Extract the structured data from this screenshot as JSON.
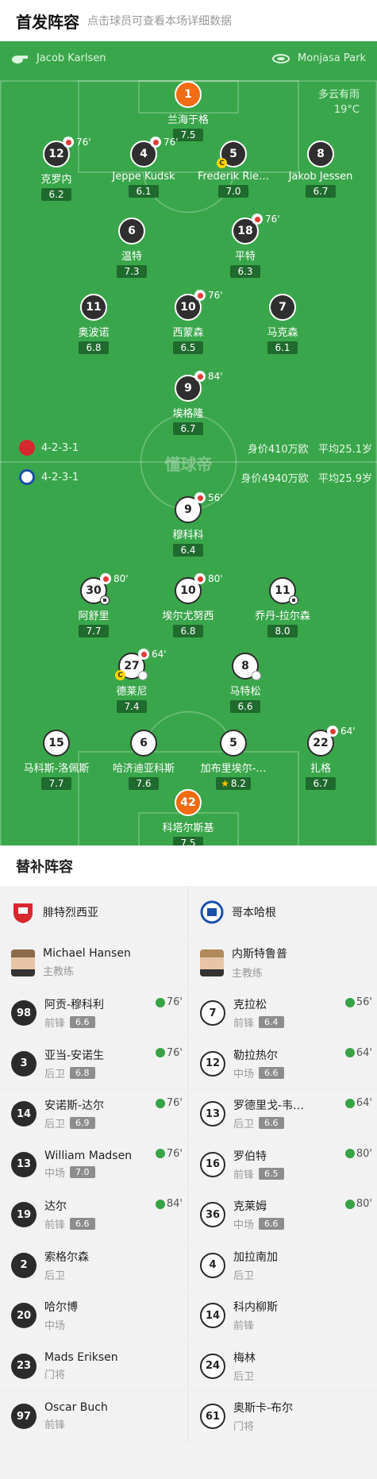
{
  "header": {
    "title": "首发阵容",
    "subtitle": "点击球员可查看本场详细数据"
  },
  "match": {
    "referee": "Jacob Karlsen",
    "venue": "Monjasa Park",
    "weather": "多云有雨",
    "temperature": "19°C"
  },
  "home_team": {
    "name": "腓特烈西亚",
    "formation": "4-2-3-1",
    "value": "身价410万欧",
    "avg_age": "平均25.1岁",
    "color": "#d7282f"
  },
  "away_team": {
    "name": "哥本哈根",
    "formation": "4-2-3-1",
    "value": "身价4940万欧",
    "avg_age": "平均25.9岁",
    "color": "#1b4fa8"
  },
  "watermark": "懂球帝",
  "home_lineup": [
    {
      "num": "1",
      "name": "兰海于格",
      "rating": "7.5"
    },
    {
      "num": "12",
      "name": "克罗内",
      "rating": "6.2",
      "sub": "76'"
    },
    {
      "num": "4",
      "name": "Jeppe Kudsk",
      "rating": "6.1",
      "sub": "76'"
    },
    {
      "num": "5",
      "name": "Frederik Rie…",
      "rating": "7.0",
      "captain": "C"
    },
    {
      "num": "8",
      "name": "Jakob Jessen",
      "rating": "6.7"
    },
    {
      "num": "6",
      "name": "温特",
      "rating": "7.3"
    },
    {
      "num": "18",
      "name": "平特",
      "rating": "6.3",
      "sub": "76'"
    },
    {
      "num": "11",
      "name": "奥波诺",
      "rating": "6.8"
    },
    {
      "num": "10",
      "name": "西蒙森",
      "rating": "6.5",
      "sub": "76'"
    },
    {
      "num": "7",
      "name": "马克森",
      "rating": "6.1"
    },
    {
      "num": "9",
      "name": "埃格隆",
      "rating": "6.7",
      "sub": "84'"
    }
  ],
  "away_lineup": [
    {
      "num": "9",
      "name": "穆科科",
      "rating": "6.4",
      "sub": "56'"
    },
    {
      "num": "30",
      "name": "阿舒里",
      "rating": "7.7",
      "sub": "80'"
    },
    {
      "num": "10",
      "name": "埃尔尤努西",
      "rating": "6.8",
      "sub": "80'"
    },
    {
      "num": "11",
      "name": "乔丹-拉尔森",
      "rating": "8.0"
    },
    {
      "num": "27",
      "name": "德莱尼",
      "rating": "7.4",
      "sub": "64'",
      "captain": "C"
    },
    {
      "num": "8",
      "name": "马特松",
      "rating": "6.6"
    },
    {
      "num": "15",
      "name": "马科斯-洛佩斯",
      "rating": "7.7"
    },
    {
      "num": "6",
      "name": "哈济迪亚科斯",
      "rating": "7.6"
    },
    {
      "num": "5",
      "name": "加布里埃尔-…",
      "rating": "8.2"
    },
    {
      "num": "22",
      "name": "扎格",
      "rating": "6.7",
      "sub": "64'"
    },
    {
      "num": "42",
      "name": "科塔尔斯基",
      "rating": "7.5"
    }
  ],
  "subs": {
    "title": "替补阵容",
    "home": {
      "club": "腓特烈西亚",
      "coach": {
        "name": "Michael Hansen",
        "role": "主教练"
      },
      "players": [
        {
          "num": "98",
          "name": "阿贡-穆科利",
          "pos": "前锋",
          "rating": "6.6",
          "in": "76'"
        },
        {
          "num": "3",
          "name": "亚当-安诺生",
          "pos": "后卫",
          "rating": "6.8",
          "in": "76'"
        },
        {
          "num": "14",
          "name": "安诺斯-达尔",
          "pos": "后卫",
          "rating": "6.9",
          "in": "76'"
        },
        {
          "num": "13",
          "name": "William Madsen",
          "pos": "中场",
          "rating": "7.0",
          "in": "76'"
        },
        {
          "num": "19",
          "name": "达尔",
          "pos": "前锋",
          "rating": "6.6",
          "in": "84'"
        },
        {
          "num": "2",
          "name": "索格尔森",
          "pos": "后卫"
        },
        {
          "num": "20",
          "name": "哈尔博",
          "pos": "中场"
        },
        {
          "num": "23",
          "name": "Mads Eriksen",
          "pos": "门将"
        },
        {
          "num": "97",
          "name": "Oscar Buch",
          "pos": "前锋"
        }
      ]
    },
    "away": {
      "club": "哥本哈根",
      "coach": {
        "name": "内斯特鲁普",
        "role": "主教练"
      },
      "players": [
        {
          "num": "7",
          "name": "克拉松",
          "pos": "前锋",
          "rating": "6.4",
          "in": "56'"
        },
        {
          "num": "12",
          "name": "勒拉热尔",
          "pos": "中场",
          "rating": "6.6",
          "in": "64'"
        },
        {
          "num": "13",
          "name": "罗德里戈-韦…",
          "pos": "后卫",
          "rating": "6.6",
          "in": "64'"
        },
        {
          "num": "16",
          "name": "罗伯特",
          "pos": "前锋",
          "rating": "6.5",
          "in": "80'"
        },
        {
          "num": "36",
          "name": "克莱姆",
          "pos": "中场",
          "rating": "6.6",
          "in": "80'"
        },
        {
          "num": "4",
          "name": "加拉南加",
          "pos": "后卫"
        },
        {
          "num": "14",
          "name": "科内柳斯",
          "pos": "前锋"
        },
        {
          "num": "24",
          "name": "梅林",
          "pos": "后卫"
        },
        {
          "num": "61",
          "name": "奥斯卡-布尔",
          "pos": "门将"
        }
      ]
    }
  }
}
